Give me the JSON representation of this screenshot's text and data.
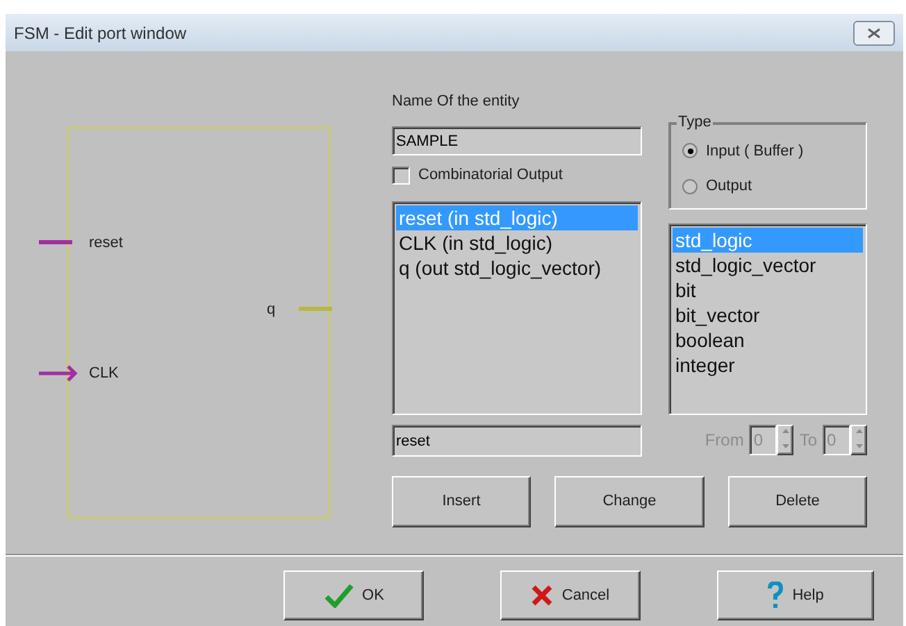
{
  "window": {
    "title": "FSM - Edit port window"
  },
  "diagram": {
    "ports": [
      {
        "name": "reset",
        "kind": "input",
        "color": "#a030a0"
      },
      {
        "name": "CLK",
        "kind": "clock",
        "color": "#a030a0"
      },
      {
        "name": "q",
        "kind": "output",
        "color": "#b8b840"
      }
    ]
  },
  "entity": {
    "label": "Name Of the entity",
    "value": "SAMPLE"
  },
  "combinatorial_output": {
    "label": "Combinatorial Output",
    "checked": false
  },
  "port_list": [
    {
      "text": "reset (in std_logic)",
      "selected": true
    },
    {
      "text": "CLK (in std_logic)",
      "selected": false
    },
    {
      "text": "q (out std_logic_vector)",
      "selected": false
    }
  ],
  "port_name": {
    "value": "reset"
  },
  "type_group": {
    "title": "Type",
    "options": [
      {
        "label": "Input ( Buffer )",
        "selected": true
      },
      {
        "label": "Output",
        "selected": false
      }
    ]
  },
  "type_list": [
    {
      "text": "std_logic",
      "selected": true
    },
    {
      "text": "std_logic_vector",
      "selected": false
    },
    {
      "text": "bit",
      "selected": false
    },
    {
      "text": "bit_vector",
      "selected": false
    },
    {
      "text": "boolean",
      "selected": false
    },
    {
      "text": "integer",
      "selected": false
    }
  ],
  "range": {
    "disabled": true,
    "from_label": "From",
    "from_value": "0",
    "to_label": "To",
    "to_value": "0"
  },
  "edit_buttons": [
    "Insert",
    "Change",
    "Delete"
  ],
  "dialog_buttons": [
    {
      "kind": "ok",
      "label": "OK"
    },
    {
      "kind": "cancel",
      "label": "Cancel"
    },
    {
      "kind": "help",
      "label": "Help"
    }
  ]
}
